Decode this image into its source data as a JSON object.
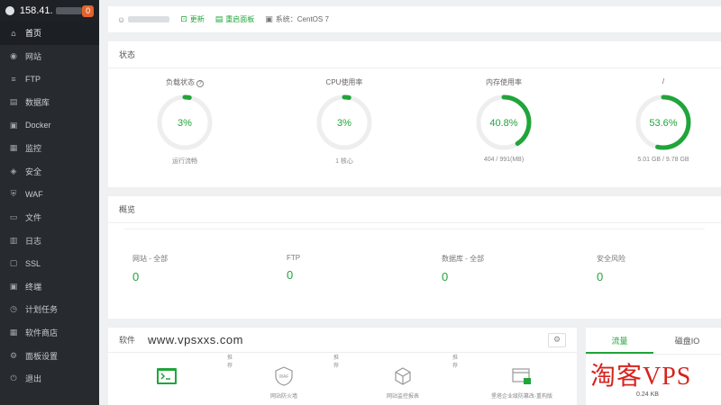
{
  "sidebar": {
    "ip": "158.41.",
    "badge": "0",
    "items": [
      {
        "label": "首页",
        "icon": "home-icon",
        "glyph": "⌂",
        "active": true
      },
      {
        "label": "网站",
        "icon": "globe-icon",
        "glyph": "◉"
      },
      {
        "label": "FTP",
        "icon": "ftp-icon",
        "glyph": "≡"
      },
      {
        "label": "数据库",
        "icon": "database-icon",
        "glyph": "▤"
      },
      {
        "label": "Docker",
        "icon": "docker-icon",
        "glyph": "▣"
      },
      {
        "label": "监控",
        "icon": "monitor-icon",
        "glyph": "▦"
      },
      {
        "label": "安全",
        "icon": "shield-icon",
        "glyph": "◈"
      },
      {
        "label": "WAF",
        "icon": "waf-icon",
        "glyph": "⛨"
      },
      {
        "label": "文件",
        "icon": "folder-icon",
        "glyph": "▭"
      },
      {
        "label": "日志",
        "icon": "log-icon",
        "glyph": "▥"
      },
      {
        "label": "SSL",
        "icon": "ssl-icon",
        "glyph": "▢"
      },
      {
        "label": "终端",
        "icon": "terminal-icon",
        "glyph": "▣"
      },
      {
        "label": "计划任务",
        "icon": "clock-icon",
        "glyph": "◷"
      },
      {
        "label": "软件商店",
        "icon": "store-icon",
        "glyph": "▦"
      },
      {
        "label": "面板设置",
        "icon": "gear-icon",
        "glyph": "⚙"
      },
      {
        "label": "退出",
        "icon": "logout-icon",
        "glyph": "⏻"
      }
    ]
  },
  "topbar": {
    "update": "更新",
    "repair": "重启面板",
    "system": "系统：CentOS 7"
  },
  "status": {
    "title": "状态",
    "accent": "#20a53a",
    "gauges": [
      {
        "label": "负载状态",
        "value_text": "3%",
        "percent": 3,
        "sub": "运行流畅",
        "help": "?"
      },
      {
        "label": "CPU使用率",
        "value_text": "3%",
        "percent": 3,
        "sub": "1 核心"
      },
      {
        "label": "内存使用率",
        "value_text": "40.8%",
        "percent": 40.8,
        "sub": "404 / 991(MB)"
      },
      {
        "label": "/",
        "value_text": "53.6%",
        "percent": 53.6,
        "sub": "5.01 GB / 9.78 GB"
      }
    ]
  },
  "overview": {
    "title": "概览",
    "items": [
      {
        "label": "网站 - 全部",
        "value": "0"
      },
      {
        "label": "FTP",
        "value": "0"
      },
      {
        "label": "数据库 - 全部",
        "value": "0"
      },
      {
        "label": "安全风险",
        "value": "0"
      }
    ]
  },
  "software": {
    "title": "软件",
    "watermark": "www.vpsxxs.com",
    "tags": [
      "推荐",
      "推荐",
      "推荐"
    ],
    "apps": [
      {
        "name": "",
        "icon": "terminal-app-icon"
      },
      {
        "name": "网站防火墙",
        "icon": "waf-app-icon"
      },
      {
        "name": "网站监控报表",
        "icon": "cube-app-icon"
      },
      {
        "name": "堡塔企业级防篡改-重构版",
        "icon": "tamper-app-icon"
      }
    ]
  },
  "traffic": {
    "tabs": [
      {
        "label": "流量",
        "active": true
      },
      {
        "label": "磁盘IO"
      }
    ],
    "value": "0.24 KB"
  },
  "brand_watermark": "淘客VPS"
}
